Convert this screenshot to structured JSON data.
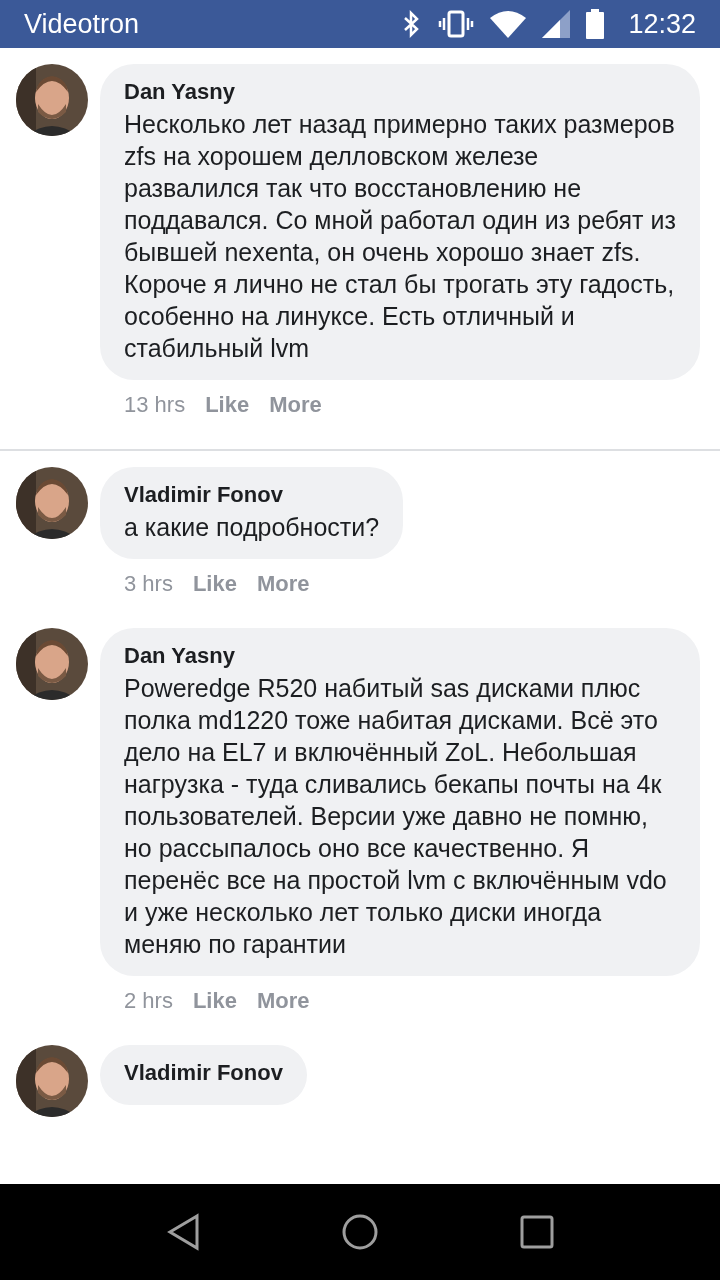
{
  "status_bar": {
    "carrier": "Videotron",
    "time": "12:32"
  },
  "threads": [
    {
      "comments": [
        {
          "author": "Dan Yasny",
          "text": "Несколько лет назад примерно таких размеров zfs на хорошем делловском железе развалился так что восстановлению не поддавался. Со мной работал один из ребят из бывшей nexenta, он очень хорошо знает zfs. Короче я лично не стал бы трогать эту гадость, особенно на линуксе. Есть отличный и стабильный lvm",
          "time": "13 hrs",
          "like": "Like",
          "more": "More"
        }
      ]
    },
    {
      "comments": [
        {
          "author": "Vladimir Fonov",
          "text": "а какие подробности?",
          "time": "3 hrs",
          "like": "Like",
          "more": "More"
        },
        {
          "author": "Dan Yasny",
          "text": "Poweredge R520 набитый sas дисками плюс полка md1220 тоже набитая дисками. Всё это дело на EL7 и включённый ZoL. Небольшая нагрузка - туда сливались бекапы почты на 4к пользователей. Версии уже давно не помню, но рассыпалось оно все качественно. Я перенёс все на простой lvm с включённым vdo и уже несколько лет только диски иногда меняю по гарантии",
          "time": "2 hrs",
          "like": "Like",
          "more": "More"
        },
        {
          "author": "Vladimir Fonov"
        }
      ]
    }
  ]
}
